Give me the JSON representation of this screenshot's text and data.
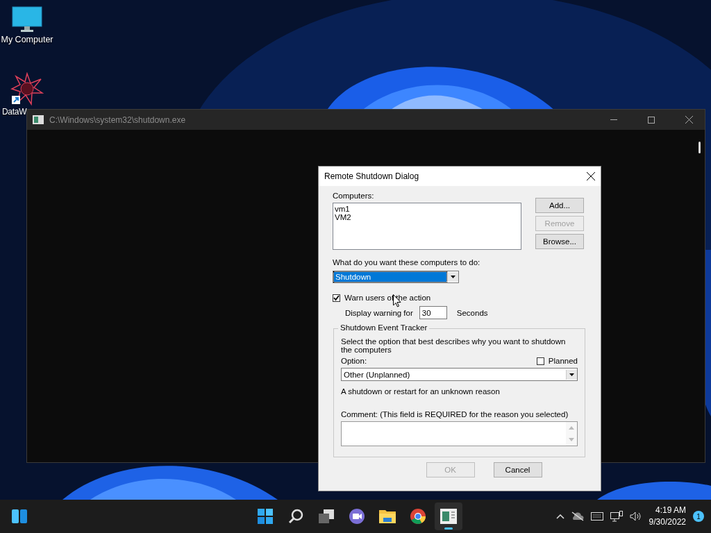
{
  "desktop_icons": [
    {
      "kind": "monitor",
      "label": "My Computer"
    },
    {
      "kind": "shortcut",
      "label": "DataW"
    }
  ],
  "console_window": {
    "title": "C:\\Windows\\system32\\shutdown.exe"
  },
  "dialog": {
    "title": "Remote Shutdown Dialog",
    "computers_label": "Computers:",
    "computers": [
      "vm1",
      "VM2"
    ],
    "buttons": [
      {
        "label": "Add...",
        "disabled": false
      },
      {
        "label": "Remove",
        "disabled": true
      },
      {
        "label": "Browse...",
        "disabled": false
      }
    ],
    "action_label": "What do you want these computers to do:",
    "action": {
      "value": "Shutdown",
      "selected": true
    },
    "warn": {
      "label": "Warn users of the action",
      "checked": true
    },
    "warning": {
      "label": "Display warning for",
      "value": "30",
      "unit": "Seconds"
    },
    "tracker": {
      "title": "Shutdown Event Tracker",
      "description": "Select the option that best describes why you want to shutdown the computers",
      "option_label": "Option:",
      "planned": {
        "label": "Planned",
        "checked": false
      },
      "option": {
        "value": "Other (Unplanned)"
      },
      "reason": "A shutdown or restart for an unknown reason",
      "comment_label": "Comment: (This field is REQUIRED for the reason you selected)"
    },
    "footer_buttons": [
      {
        "label": "OK",
        "disabled": true
      },
      {
        "label": "Cancel",
        "disabled": false
      }
    ]
  },
  "taskbar": {
    "apps": [
      {
        "kind": "start",
        "active": false
      },
      {
        "kind": "search",
        "active": false
      },
      {
        "kind": "taskview",
        "active": false
      },
      {
        "kind": "chat",
        "active": false
      },
      {
        "kind": "folder",
        "active": false
      },
      {
        "kind": "browser",
        "active": false
      },
      {
        "kind": "console",
        "active": true
      }
    ],
    "time": "4:19 AM",
    "date": "9/30/2022",
    "notifications": "1"
  }
}
